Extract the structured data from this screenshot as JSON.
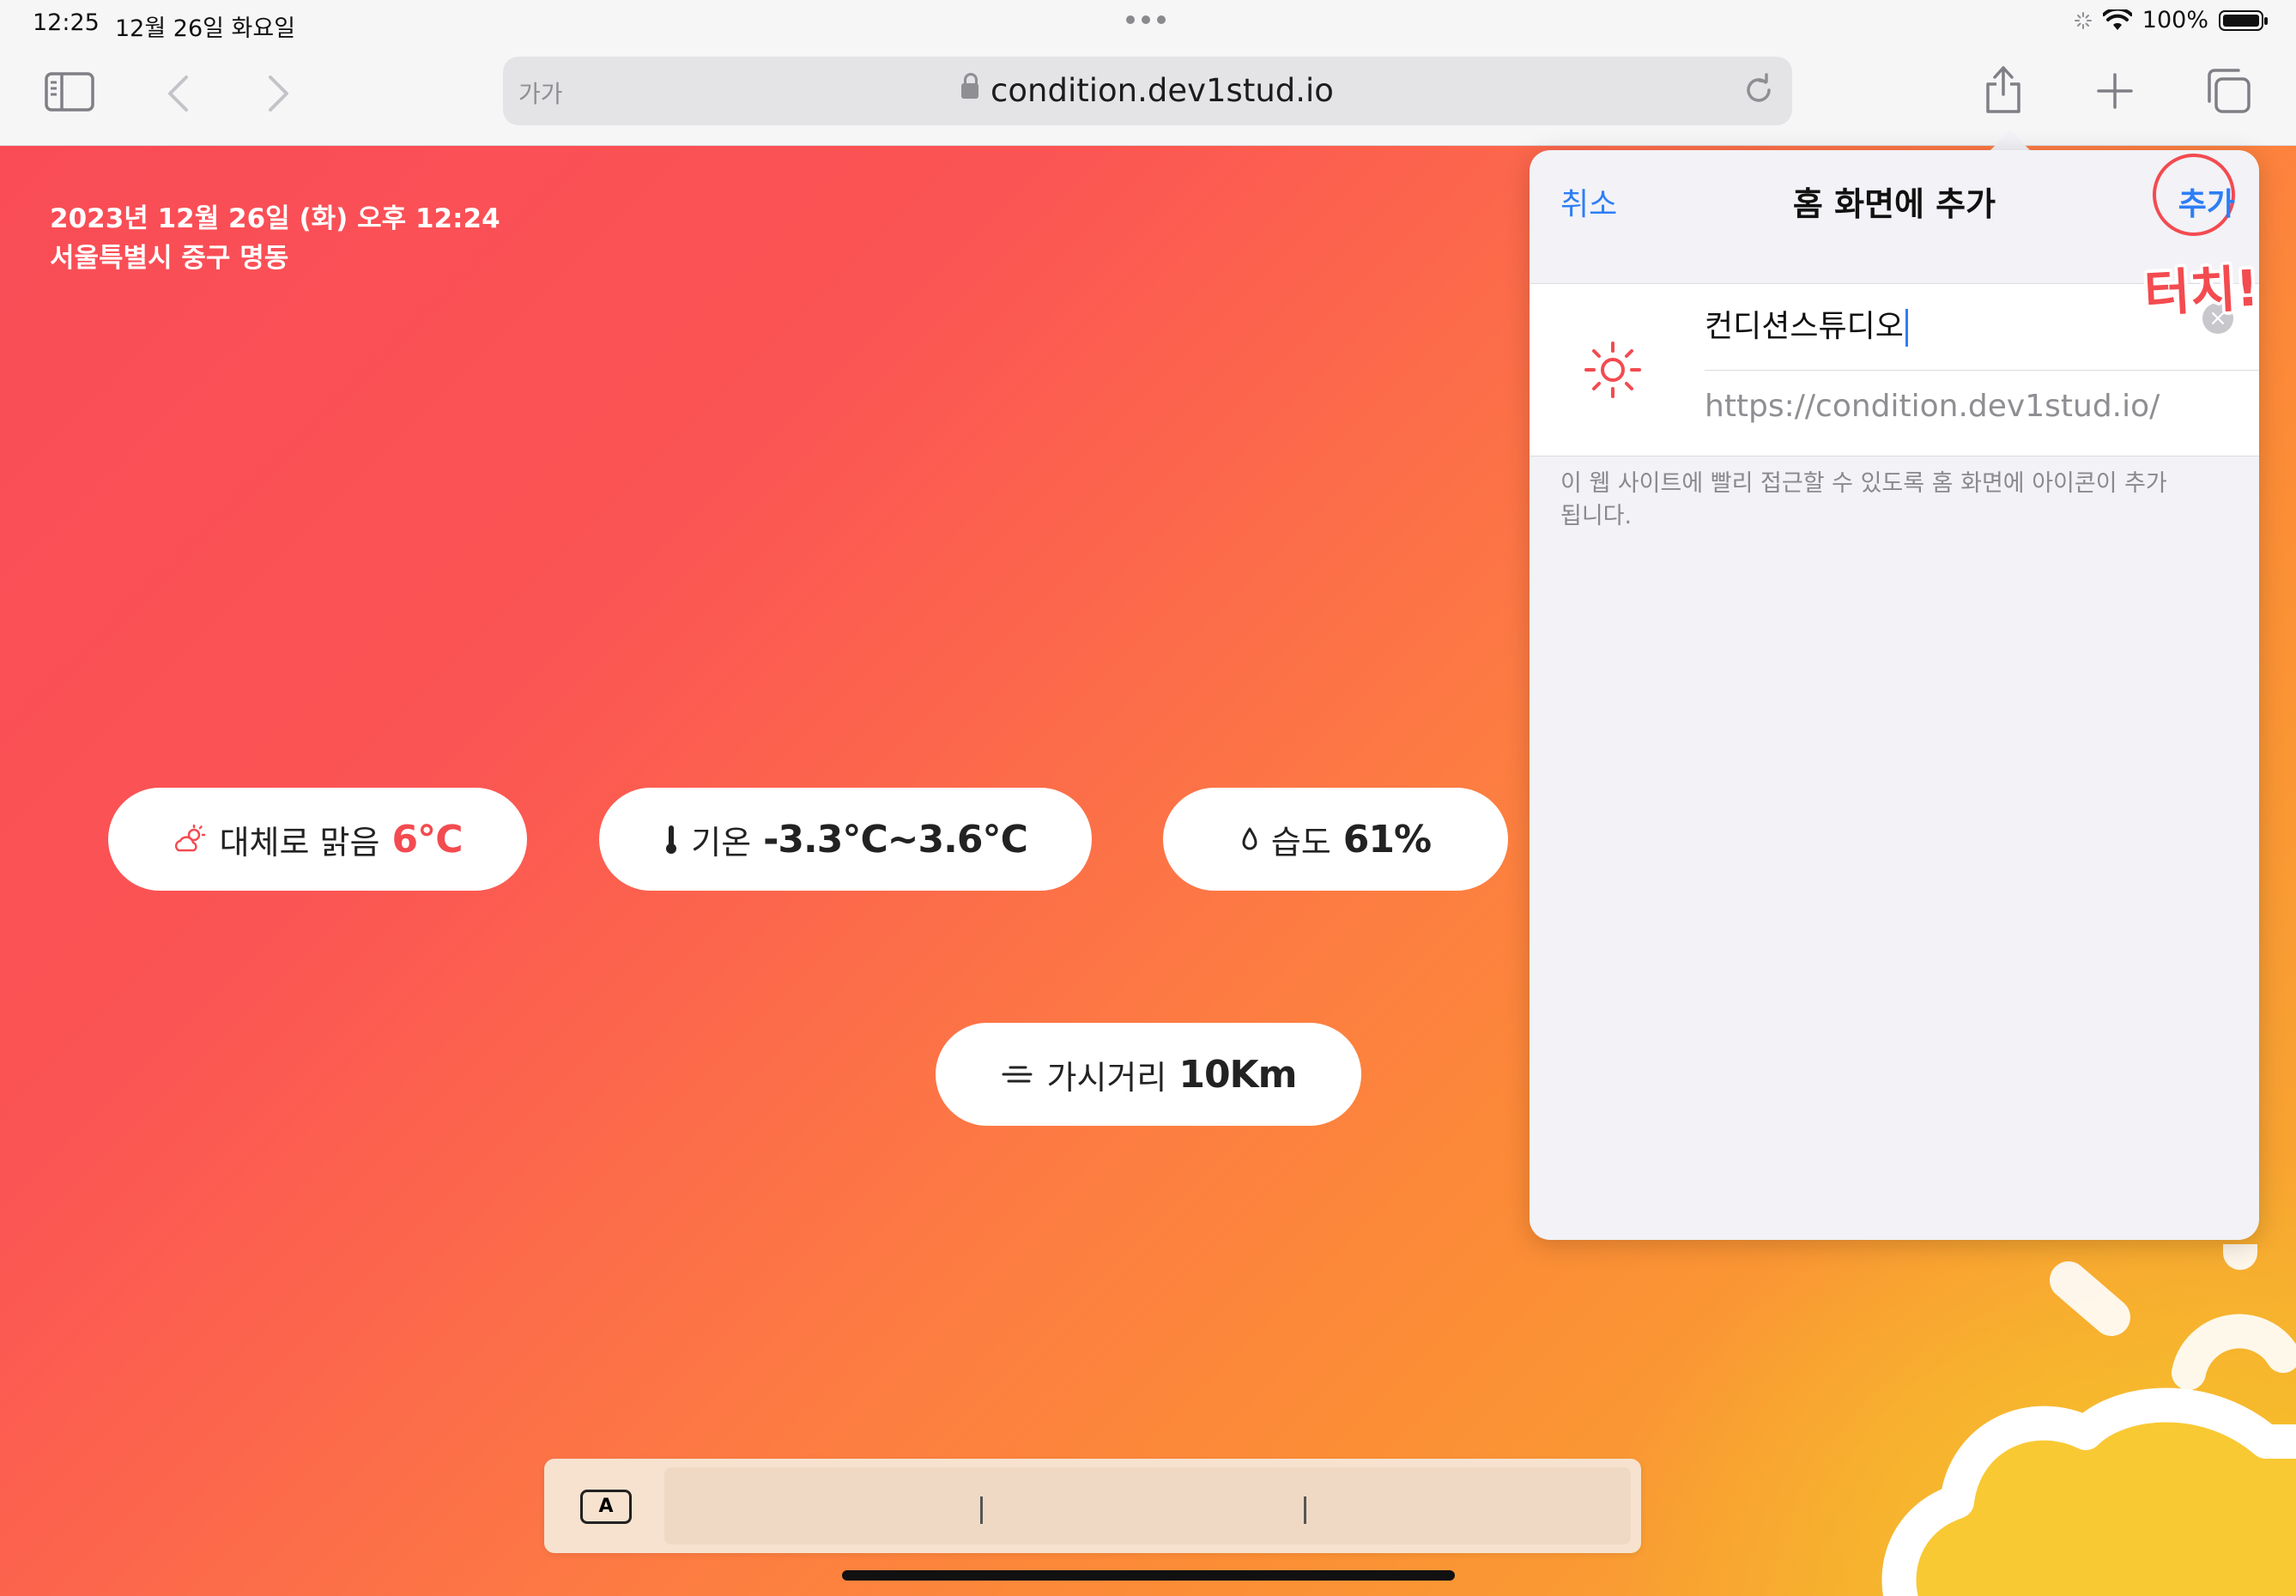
{
  "status_bar": {
    "time": "12:25",
    "date": "12월 26일 화요일",
    "battery": "100%"
  },
  "toolbar": {
    "text_size_label": "가가",
    "url": "condition.dev1stud.io"
  },
  "page": {
    "datetime": "2023년 12월 26일 (화) 오후 12:24",
    "location": "서울특별시 중구 명동",
    "weather": {
      "label": "대체로 맑음",
      "value": "6℃"
    },
    "temperature": {
      "label": "기온",
      "value": "-3.3℃~3.6℃"
    },
    "humidity": {
      "label": "습도",
      "value": "61%"
    },
    "visibility": {
      "label": "가시거리",
      "value": "10Km"
    }
  },
  "shortcut_bar": {
    "key_label": "A"
  },
  "popover": {
    "cancel_label": "취소",
    "title": "홈 화면에 추가",
    "add_label": "추가",
    "app_name": "컨디션스튜디오",
    "app_url": "https://condition.dev1stud.io/",
    "description": "이 웹 사이트에 빨리 접근할 수 있도록 홈 화면에 아이콘이 추가됩니다."
  },
  "annotation": {
    "touch_label": "터치!"
  },
  "colors": {
    "accent_blue": "#2d7ef5",
    "highlight_red": "#f34b50",
    "bg_gradient_start": "#f94c57",
    "bg_gradient_end": "#f5b22e"
  },
  "icons": {
    "sidebar": "sidebar-icon",
    "back": "chevron-left-icon",
    "forward": "chevron-right-icon",
    "reload": "reload-icon",
    "share": "share-icon",
    "new_tab": "plus-icon",
    "tabs": "tabs-icon",
    "weather": "partly-cloudy-icon",
    "temperature": "thermometer-icon",
    "humidity": "droplet-icon",
    "visibility": "fog-icon",
    "app": "sun-icon"
  }
}
